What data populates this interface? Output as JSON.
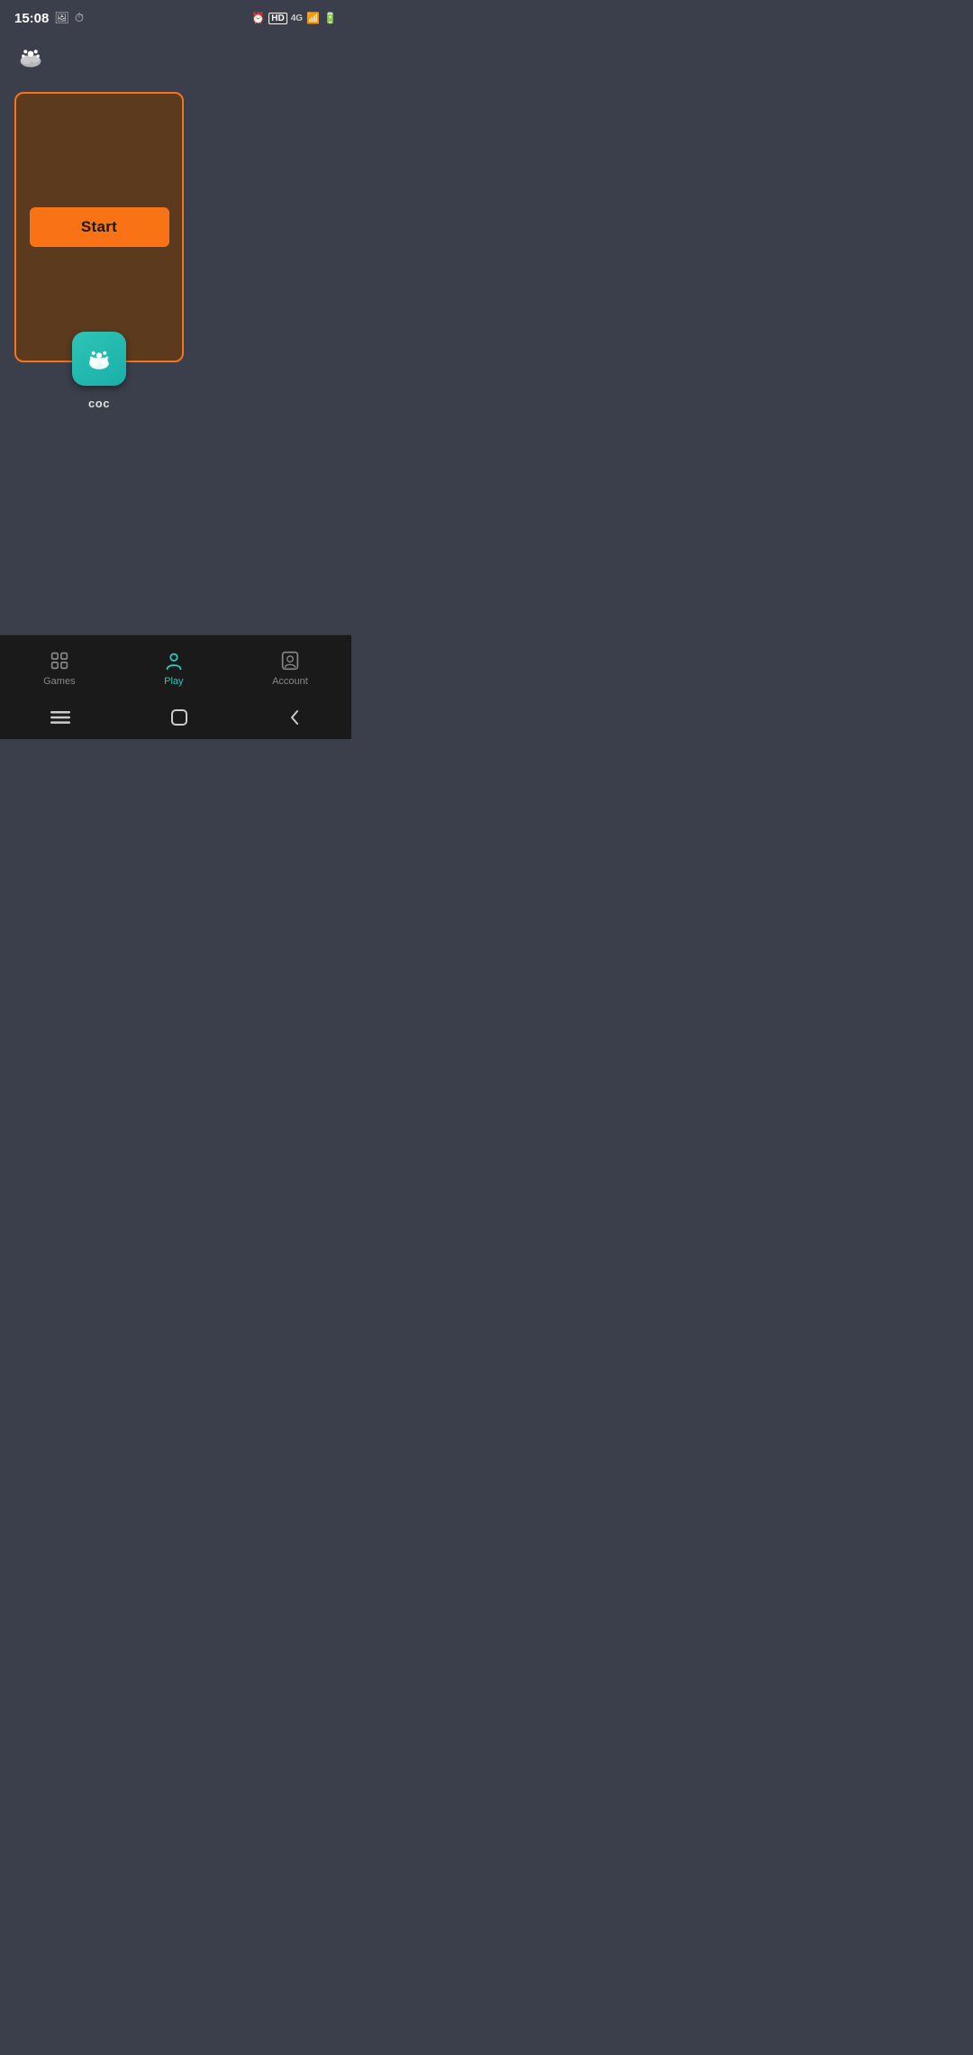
{
  "statusBar": {
    "time": "15:08",
    "icons": [
      "image-icon",
      "clock-icon"
    ],
    "rightIcons": [
      "alarm-icon",
      "hd-badge",
      "4g-icon",
      "signal-icon",
      "battery-icon"
    ]
  },
  "header": {
    "logo": "paw-cloud-icon"
  },
  "gameCard": {
    "startLabel": "Start",
    "gameName": "coc"
  },
  "bottomNav": {
    "items": [
      {
        "id": "games",
        "label": "Games",
        "active": false
      },
      {
        "id": "play",
        "label": "Play",
        "active": true
      },
      {
        "id": "account",
        "label": "Account",
        "active": false
      }
    ]
  },
  "systemNav": {
    "buttons": [
      "recents",
      "home",
      "back"
    ]
  }
}
